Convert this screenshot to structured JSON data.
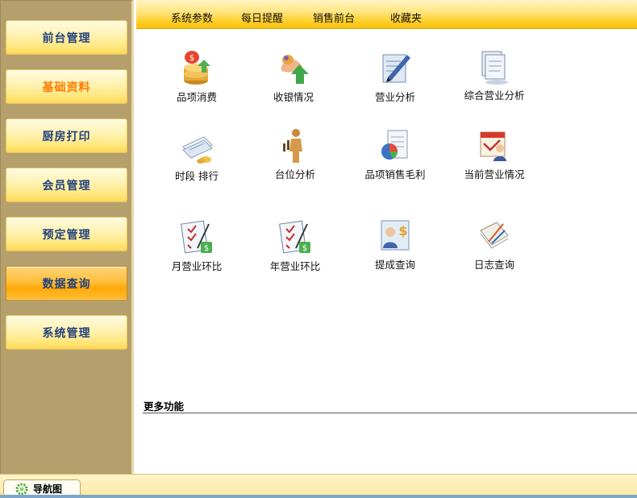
{
  "sidebar": {
    "items": [
      {
        "label": "前台管理"
      },
      {
        "label": "基础资料"
      },
      {
        "label": "厨房打印"
      },
      {
        "label": "会员管理"
      },
      {
        "label": "预定管理"
      },
      {
        "label": "数据查询"
      },
      {
        "label": "系统管理"
      }
    ],
    "active_label": "数据查询",
    "highlight_color": "#ff7a00",
    "text_color": "#23417d"
  },
  "topbar": {
    "items": [
      "系统参数",
      "每日提醒",
      "销售前台",
      "收藏夹"
    ]
  },
  "grid": {
    "tiles": [
      {
        "label": "品项消费",
        "icon": "coins-stack-icon"
      },
      {
        "label": "收银情况",
        "icon": "cashier-hand-icon"
      },
      {
        "label": "营业分析",
        "icon": "document-pen-icon"
      },
      {
        "label": "综合营业分析",
        "icon": "documents-stack-icon"
      },
      {
        "label": "时段  排行",
        "icon": "papers-clock-icon"
      },
      {
        "label": "台位分析",
        "icon": "people-figure-icon"
      },
      {
        "label": "品项销售毛利",
        "icon": "pie-chart-document-icon"
      },
      {
        "label": "当前营业情况",
        "icon": "calendar-user-icon"
      },
      {
        "label": "月营业环比",
        "icon": "checklist-money-icon"
      },
      {
        "label": "年营业环比",
        "icon": "checklist-money-icon"
      },
      {
        "label": "提成查询",
        "icon": "person-dollar-icon"
      },
      {
        "label": "日志查询",
        "icon": "log-pencil-icon"
      }
    ]
  },
  "more": {
    "title": "更多功能"
  },
  "statusbar": {
    "tab_label": "导航图",
    "tab_icon": "gear-icon"
  }
}
